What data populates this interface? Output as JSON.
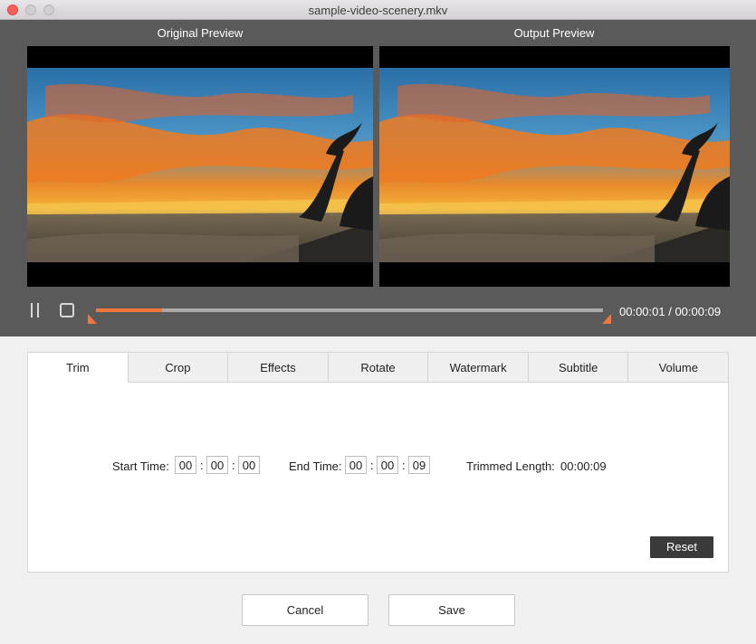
{
  "window": {
    "title": "sample-video-scenery.mkv"
  },
  "preview": {
    "original_label": "Original Preview",
    "output_label": "Output  Preview"
  },
  "playback": {
    "time": "00:00:01 / 00:00:09",
    "progress": 0.13,
    "accent_color": "#f0783c"
  },
  "tabs": [
    {
      "label": "Trim",
      "active": true
    },
    {
      "label": "Crop"
    },
    {
      "label": "Effects"
    },
    {
      "label": "Rotate"
    },
    {
      "label": "Watermark"
    },
    {
      "label": "Subtitle"
    },
    {
      "label": "Volume"
    }
  ],
  "trim": {
    "start_label": "Start Time:",
    "start": [
      "00",
      "00",
      "00"
    ],
    "end_label": "End Time:",
    "end": [
      "00",
      "00",
      "09"
    ],
    "length_label": "Trimmed Length:",
    "length_value": "00:00:09",
    "separator": ":",
    "reset_label": "Reset"
  },
  "footer": {
    "cancel_label": "Cancel",
    "save_label": "Save"
  }
}
